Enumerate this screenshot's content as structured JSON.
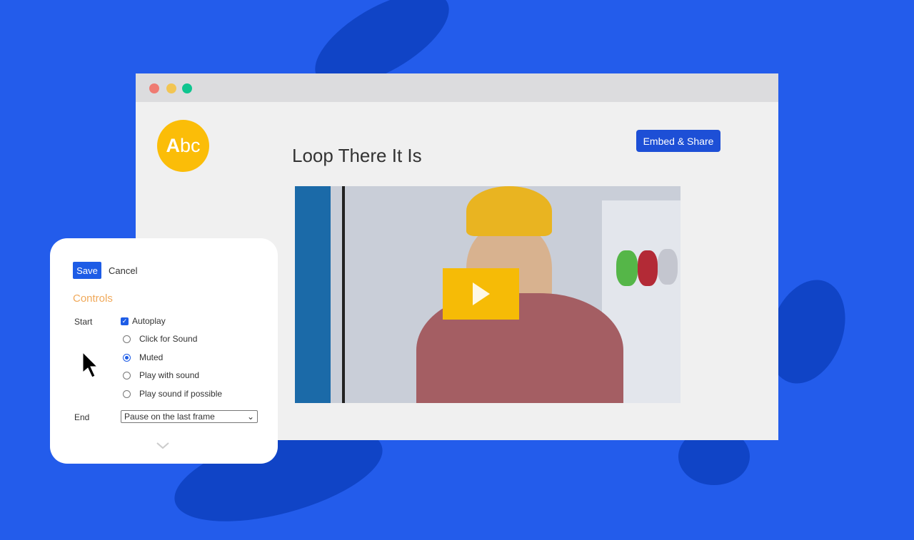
{
  "window": {
    "traffic_lights": [
      "#ef7b72",
      "#f2c552",
      "#0fc58f"
    ]
  },
  "logo": {
    "text_a": "A",
    "text_bc": "bc",
    "color": "#fbbd08"
  },
  "page": {
    "title": "Loop There It Is",
    "embed_label": "Embed & Share"
  },
  "video": {
    "play_icon": "play-icon",
    "play_color": "#f6bb06"
  },
  "panel": {
    "save_label": "Save",
    "cancel_label": "Cancel",
    "section_title": "Controls",
    "start_label": "Start",
    "autoplay_label": "Autoplay",
    "autoplay_checked": true,
    "start_options": [
      "Click for Sound",
      "Muted",
      "Play with sound",
      "Play sound if possible"
    ],
    "selected_option": "Muted",
    "end_label": "End",
    "end_value": "Pause on the last frame"
  }
}
